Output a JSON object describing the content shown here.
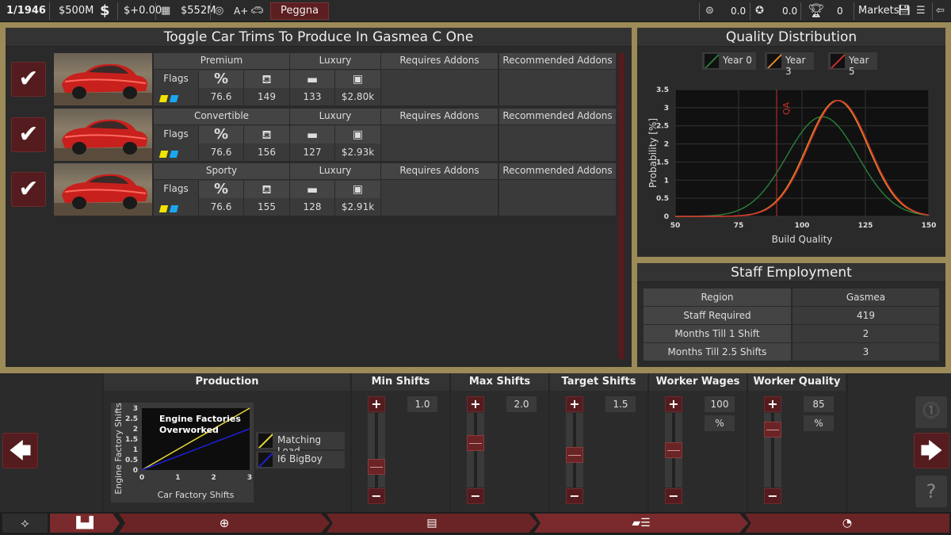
{
  "topbar": {
    "date": "1/1946",
    "money": "$500M",
    "money_change": "$+0.00",
    "value": "$552M",
    "grade": "A+",
    "company": "Peggna",
    "stat1": "0.0",
    "stat2": "0.0",
    "trophies": "0",
    "markets": "Markets"
  },
  "trims_panel": {
    "title": "Toggle Car Trims To Produce In Gasmea C One",
    "col_addons_req": "Requires Addons",
    "col_addons_rec": "Recommended Addons",
    "flags_label": "Flags",
    "percent_symbol": "%",
    "trims": [
      {
        "name": "Premium",
        "type": "Luxury",
        "pct": "76.6",
        "v1": "149",
        "v2": "133",
        "price": "$2.80k"
      },
      {
        "name": "Convertible",
        "type": "Luxury",
        "pct": "76.6",
        "v1": "156",
        "v2": "127",
        "price": "$2.93k"
      },
      {
        "name": "Sporty",
        "type": "Luxury",
        "pct": "76.6",
        "v1": "155",
        "v2": "128",
        "price": "$2.91k"
      }
    ]
  },
  "quality": {
    "title": "Quality Distribution",
    "legend": [
      "Year 0",
      "Year 3",
      "Year 5"
    ],
    "colors": [
      "#2a7a3a",
      "#e08a2a",
      "#c9302c"
    ],
    "qa_label": "QA"
  },
  "chart_data": [
    {
      "type": "line",
      "xlabel": "Build Quality",
      "ylabel": "Probability [%]",
      "xlim": [
        50,
        150
      ],
      "ylim": [
        0,
        3.5
      ],
      "xticks": [
        "50",
        "75",
        "100",
        "125",
        "150"
      ],
      "yticks": [
        "0",
        "0.5",
        "1",
        "1.5",
        "2",
        "2.5",
        "3",
        "3.5"
      ],
      "qa_line": 90,
      "legend_position": "top",
      "grid": true,
      "series": [
        {
          "name": "Year 0",
          "mean": 108,
          "peak": 2.75,
          "sd": 14
        },
        {
          "name": "Year 3",
          "mean": 114,
          "peak": 3.2,
          "sd": 12
        },
        {
          "name": "Year 5",
          "mean": 114.5,
          "peak": 3.2,
          "sd": 12
        }
      ]
    },
    {
      "type": "line",
      "xlabel": "Car Factory Shifts",
      "ylabel": "Engine Factory Shifts",
      "xlim": [
        0,
        3
      ],
      "ylim": [
        0,
        3
      ],
      "xticks": [
        "0",
        "1",
        "2",
        "3"
      ],
      "yticks": [
        "0",
        "0.5",
        "1",
        "1.5",
        "2",
        "2.5",
        "3"
      ],
      "annotation": "Engine Factories Overworked",
      "series": [
        {
          "name": "Matching Load",
          "x": [
            0,
            3
          ],
          "y": [
            0,
            3
          ],
          "color": "#e8d838"
        },
        {
          "name": "I6 BigBoy",
          "x": [
            0,
            3
          ],
          "y": [
            0,
            2
          ],
          "color": "#1f1fd8"
        }
      ]
    }
  ],
  "staff": {
    "title": "Staff Employment",
    "rows": [
      {
        "label": "Region",
        "value": "Gasmea"
      },
      {
        "label": "Staff Required",
        "value": "419"
      },
      {
        "label": "Months Till 1 Shift",
        "value": "2"
      },
      {
        "label": "Months Till 2.5 Shifts",
        "value": "3"
      }
    ]
  },
  "production": {
    "title": "Production",
    "legend": [
      "Matching Load",
      "I6 BigBoy"
    ],
    "annotation_line1": "Engine Factories",
    "annotation_line2": "Overworked"
  },
  "sliders": [
    {
      "title": "Min Shifts",
      "value": "1.0",
      "unit": "",
      "level": 0.22
    },
    {
      "title": "Max Shifts",
      "value": "2.0",
      "unit": "",
      "level": 0.62
    },
    {
      "title": "Target Shifts",
      "value": "1.5",
      "unit": "",
      "level": 0.42
    },
    {
      "title": "Worker Wages",
      "value": "100",
      "unit": "%",
      "level": 0.5
    },
    {
      "title": "Worker Quality",
      "value": "85",
      "unit": "%",
      "level": 0.85
    }
  ]
}
